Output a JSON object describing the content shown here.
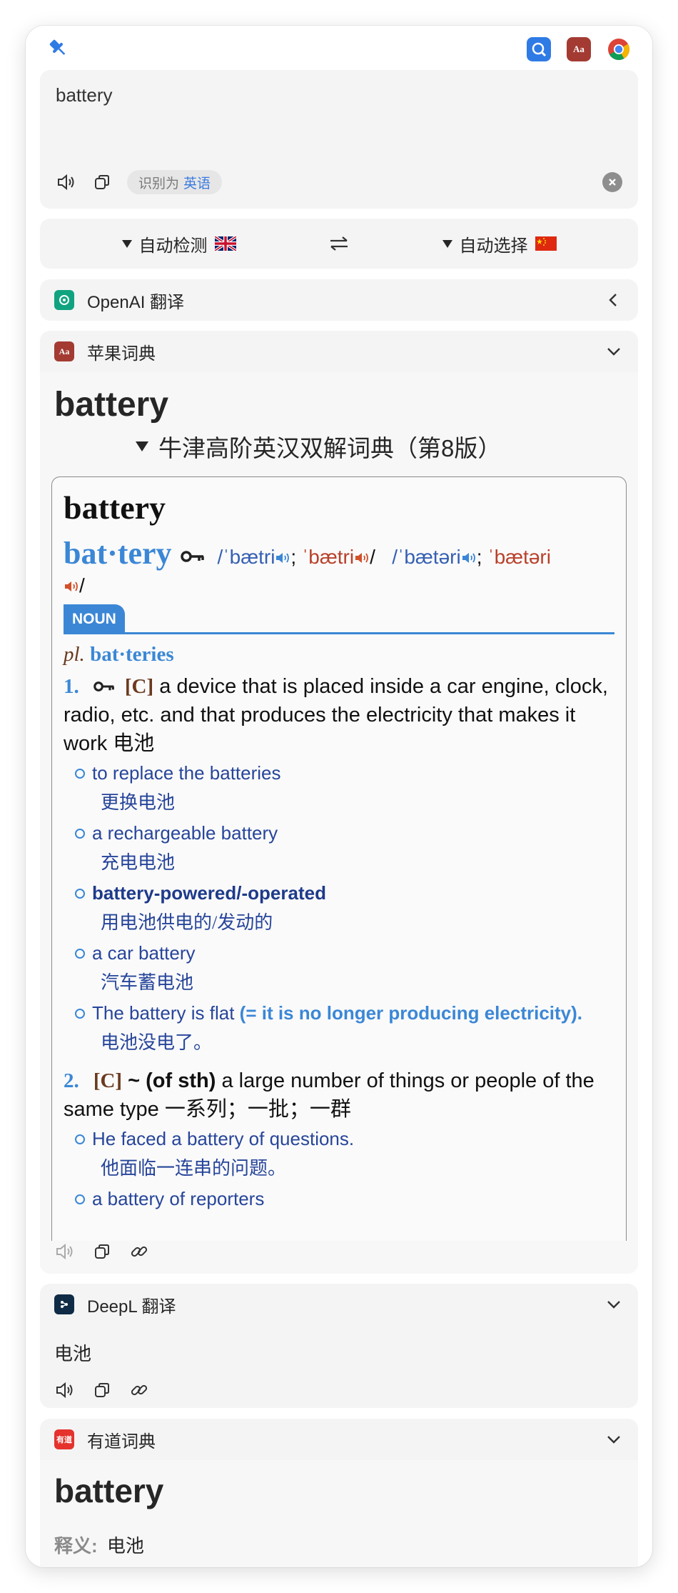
{
  "topbar": {
    "pin_icon": "pin-icon",
    "apps": [
      "easydict-icon",
      "dictionary-icon",
      "chrome-icon"
    ],
    "dict_icon_label": "Aa"
  },
  "input": {
    "text": "battery",
    "detect_prefix": "识别为",
    "detect_lang": "英语"
  },
  "languages": {
    "source": "自动检测",
    "target": "自动选择"
  },
  "services": {
    "openai": {
      "name": "OpenAI 翻译"
    },
    "apple": {
      "name": "苹果词典",
      "headword": "battery",
      "dictionary": "牛津高阶英汉双解词典（第8版）",
      "entry": {
        "headword": "battery",
        "syllables": "bat·tery",
        "pron_bre_1": "/ˈbætri",
        "pron_ame_1": "ˈbætri",
        "pron_bre_2": "/ˈbætəri",
        "pron_ame_2": "ˈbætəri",
        "pos": "NOUN",
        "plural_label": "pl.",
        "plural": "bat·teries",
        "senses": [
          {
            "num": "1.",
            "grammar": "[C]",
            "definition": "a device that is placed inside a car engine, clock, radio, etc. and that produces the electricity that makes it work",
            "translation": "电池",
            "examples": [
              {
                "en": "to replace the batteries",
                "zh": "更换电池"
              },
              {
                "en": "a rechargeable battery",
                "zh": "充电电池"
              },
              {
                "en": "battery-powered/-operated",
                "zh": "用电池供电的/发动的"
              },
              {
                "en": "a car battery",
                "zh": "汽车蓄电池"
              },
              {
                "en": "The battery is flat",
                "gloss": "(= it is no longer producing electricity).",
                "zh": "电池没电了。"
              }
            ]
          },
          {
            "num": "2.",
            "grammar": "[C]",
            "pattern": "~ (of sth)",
            "definition": "a large number of things or people of the same type",
            "translation": "一系列；一批；一群",
            "examples": [
              {
                "en": "He faced a battery of questions.",
                "zh": "他面临一连串的问题。"
              },
              {
                "en": "a battery of reporters"
              }
            ]
          }
        ]
      }
    },
    "deepl": {
      "name": "DeepL 翻译",
      "result": "电池"
    },
    "youdao": {
      "name": "有道词典",
      "logo_text": "有道",
      "word": "battery",
      "def_label": "释义:",
      "definition": "电池"
    }
  },
  "colors": {
    "accent_blue": "#3b87d6",
    "example_blue": "#27459a",
    "ame_red": "#b8402a",
    "grammar_brown": "#6b3a1f",
    "card_bg": "#f4f4f4"
  }
}
